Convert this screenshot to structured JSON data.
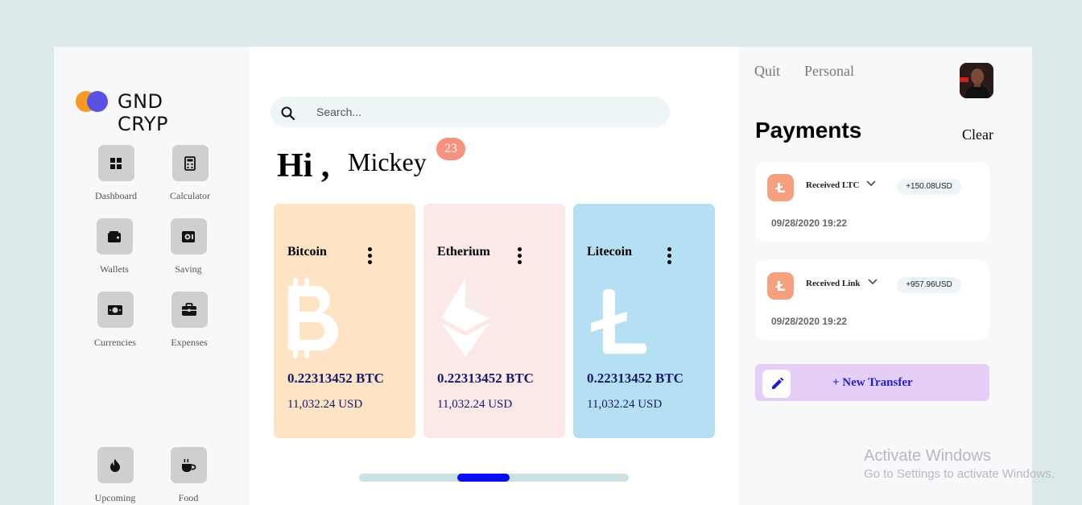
{
  "brand": {
    "name": "GND CRYP"
  },
  "sidebar": {
    "items": [
      {
        "label": "Dashboard",
        "icon": "grid-icon"
      },
      {
        "label": "Calculator",
        "icon": "calculator-icon"
      },
      {
        "label": "Wallets",
        "icon": "wallet-icon"
      },
      {
        "label": "Saving",
        "icon": "safe-icon"
      },
      {
        "label": "Currencies",
        "icon": "banknote-icon"
      },
      {
        "label": "Expenses",
        "icon": "briefcase-icon"
      },
      {
        "label": "Upcoming",
        "icon": "fire-icon"
      },
      {
        "label": "Food",
        "icon": "coffee-icon"
      }
    ]
  },
  "search": {
    "placeholder": "Search..."
  },
  "greeting": {
    "hi": "Hi ,",
    "name": "Mickey",
    "badge": "23"
  },
  "cards": [
    {
      "name": "Bitcoin",
      "amount": "0.22313452 BTC",
      "usd": "11,032.24 USD",
      "color": "#fee3c4",
      "icon": "bitcoin-icon"
    },
    {
      "name": "Etherium",
      "amount": "0.22313452 BTC",
      "usd": "11,032.24 USD",
      "color": "#fde8e8",
      "icon": "ethereum-icon"
    },
    {
      "name": "Litecoin",
      "amount": "0.22313452 BTC",
      "usd": "11,032.24 USD",
      "color": "#b5e0f3",
      "icon": "litecoin-icon"
    }
  ],
  "carousel": {
    "position": 0.45
  },
  "top_links": {
    "quit": "Quit",
    "personal": "Personal"
  },
  "payments": {
    "title": "Payments",
    "clear": "Clear",
    "items": [
      {
        "label": "Received LTC",
        "amount": "+150.08USD",
        "date": "09/28/2020 19:22"
      },
      {
        "label": "Received Link",
        "amount": "+957.96USD",
        "date": "09/28/2020 19:22"
      }
    ],
    "new_transfer": "+ New Transfer"
  },
  "watermark": {
    "title": "Activate Windows",
    "subtitle": "Go to Settings to activate Windows."
  },
  "colors": {
    "accent": "#0a0df2",
    "badge": "#f5937c",
    "ltc_icon": "#f7a080",
    "transfer_bg": "#e6cff6"
  }
}
